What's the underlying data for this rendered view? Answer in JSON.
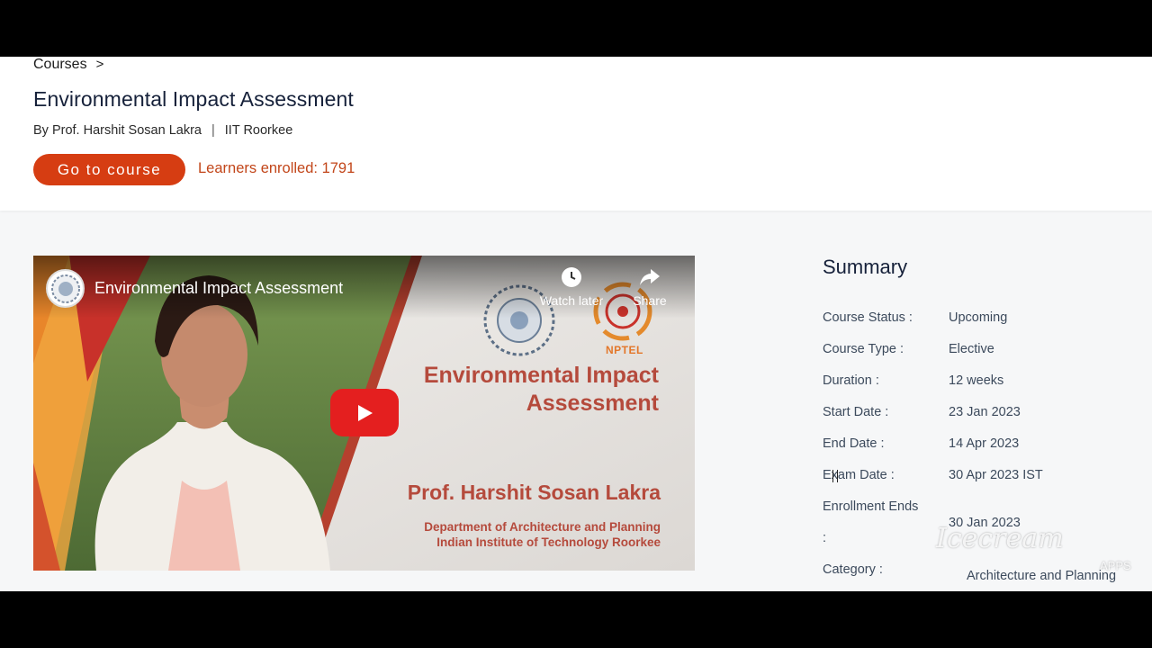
{
  "breadcrumb": {
    "courses": "Courses",
    "sep": ">"
  },
  "course": {
    "title": "Environmental Impact Assessment",
    "byline_prefix": "By Prof. Harshit Sosan Lakra",
    "pipe": "|",
    "institute": "IIT Roorkee",
    "go_button": "Go to course",
    "learners": "Learners enrolled: 1791"
  },
  "video": {
    "title": "Environmental Impact Assessment",
    "watch_later": "Watch later",
    "share": "Share",
    "nptel": "NPTEL",
    "slide_title_line1": "Environmental Impact",
    "slide_title_line2": "Assessment",
    "prof_name": "Prof. Harshit Sosan Lakra",
    "dept_line1": "Department of Architecture and Planning",
    "dept_line2": "Indian Institute of Technology Roorkee"
  },
  "summary": {
    "heading": "Summary",
    "rows": [
      {
        "label": "Course Status :",
        "value": "Upcoming"
      },
      {
        "label": "Course Type :",
        "value": "Elective"
      },
      {
        "label": "Duration :",
        "value": "12 weeks"
      },
      {
        "label": "Start Date :",
        "value": "23 Jan 2023"
      },
      {
        "label": "End Date :",
        "value": "14 Apr 2023"
      },
      {
        "label": "Exam Date :",
        "value": "30 Apr 2023 IST"
      },
      {
        "label": "Enrollment Ends",
        "label2": ":",
        "value": "30 Jan 2023"
      },
      {
        "label": "Category :",
        "value": "Architecture and Planning"
      }
    ]
  },
  "watermark": {
    "text": "Icecream",
    "sub": "APPS"
  },
  "colors": {
    "accent": "#d63d12",
    "learners": "#c2461a",
    "slide_text": "#b54a3c"
  }
}
